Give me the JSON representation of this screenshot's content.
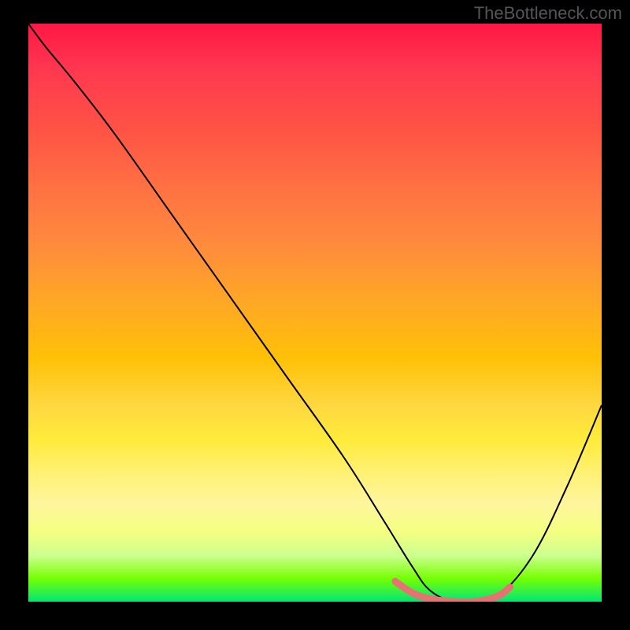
{
  "watermark": "TheBottleneck.com",
  "chart_data": {
    "type": "line",
    "title": "",
    "xlabel": "",
    "ylabel": "",
    "xlim": [
      0,
      100
    ],
    "ylim": [
      0,
      100
    ],
    "series": [
      {
        "name": "curve",
        "color": "#000000",
        "x": [
          0,
          3,
          8,
          15,
          25,
          35,
          45,
          55,
          62,
          67,
          70,
          74,
          78,
          82,
          88,
          94,
          100
        ],
        "y": [
          100,
          96,
          90,
          81,
          67,
          53,
          39,
          25,
          14,
          6,
          2,
          0,
          0,
          1,
          8,
          20,
          34
        ]
      },
      {
        "name": "highlight-band",
        "color": "#e57373",
        "x": [
          64,
          67,
          70,
          74,
          78,
          82,
          84
        ],
        "y": [
          3.5,
          1.5,
          0.5,
          0,
          0,
          1,
          2.5
        ]
      }
    ],
    "gradient_stops": [
      {
        "pos": 0,
        "color": "#ff1744"
      },
      {
        "pos": 50,
        "color": "#ffc107"
      },
      {
        "pos": 80,
        "color": "#ffeb3b"
      },
      {
        "pos": 100,
        "color": "#00e676"
      }
    ]
  }
}
